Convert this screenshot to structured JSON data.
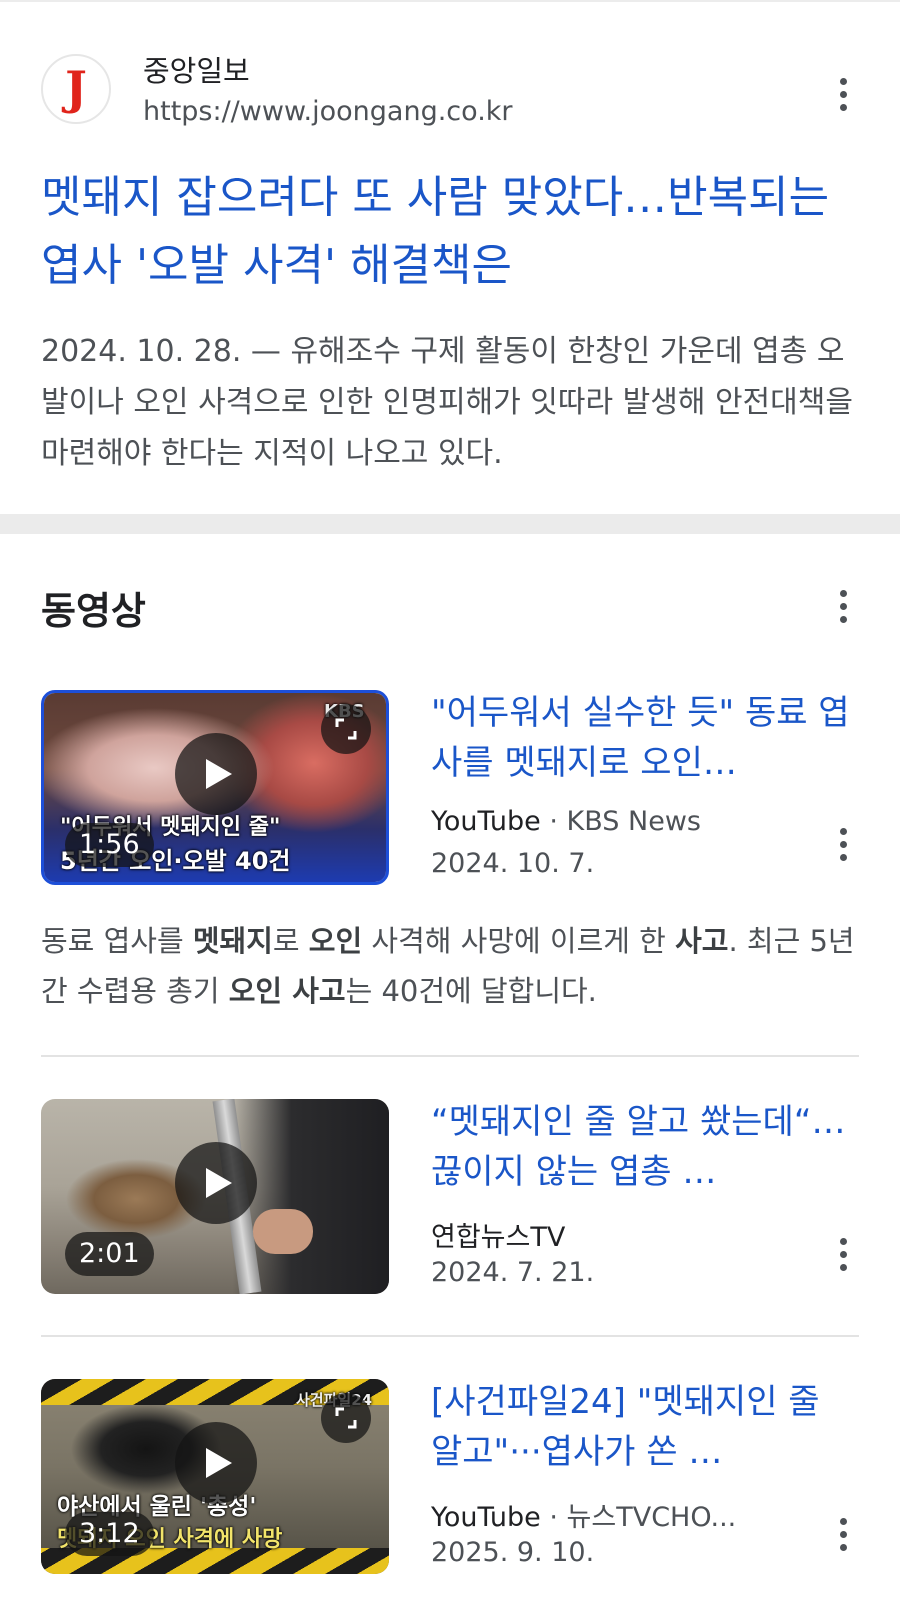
{
  "news": {
    "logo_letter": "J",
    "site_name": "중앙일보",
    "site_url": "https://www.joongang.co.kr",
    "title": "멧돼지 잡으려다 또 사람 맞았다…반복되는 엽사 '오발 사격' 해결책은",
    "snippet": "2024. 10. 28. — 유해조수 구제 활동이 한창인 가운데 엽총 오발이나 오인 사격으로 인한 인명피해가 잇따라 발생해 안전대책을 마련해야 한다는 지적이 나오고 있다."
  },
  "videos": {
    "header": "동영상",
    "items": [
      {
        "thumb_line1": "\"어두워서 멧돼지인 줄\"",
        "thumb_line2": "5년간 오인·오발 40건",
        "thumb_brand": "KBS",
        "duration": "1:56",
        "title": "\"어두워서 실수한 듯\" 동료 엽사를 멧돼지로 오인…",
        "platform": "YouTube",
        "separator": " · ",
        "channel": "KBS News",
        "date": "2024. 10. 7.",
        "snippet_parts": [
          {
            "text": "동료 엽사를 ",
            "bold": false
          },
          {
            "text": "멧돼지",
            "bold": true
          },
          {
            "text": "로 ",
            "bold": false
          },
          {
            "text": "오인",
            "bold": true
          },
          {
            "text": " 사격해 사망에 이르게 한 ",
            "bold": false
          },
          {
            "text": "사고",
            "bold": true
          },
          {
            "text": ". 최근 5년간 수렵용 총기 ",
            "bold": false
          },
          {
            "text": "오인 사고",
            "bold": true
          },
          {
            "text": "는 40건에 달합니다.",
            "bold": false
          }
        ]
      },
      {
        "duration": "2:01",
        "title": "“멧돼지인 줄 알고 쐈는데“…끊이지 않는 엽총 …",
        "channel": "연합뉴스TV",
        "date": "2024. 7. 21."
      },
      {
        "thumb_line1": "야산에서 울린 '총성'",
        "thumb_line2": "멧돼지 오인 사격에 사망",
        "thumb_brand": "사건파일24",
        "duration": "3:12",
        "title": "[사건파일24] \"멧돼지인 줄 알고\"···엽사가 쏜 …",
        "platform": "YouTube",
        "separator": " · ",
        "channel": "뉴스TVCHO...",
        "date": "2025. 9. 10."
      }
    ]
  },
  "colors": {
    "link": "#1a56c8",
    "secondary_text": "#4d5156",
    "logo_red": "#e0241b",
    "separator": "#ebebeb"
  },
  "icons": [
    "more-vert-icon",
    "play-icon",
    "expand-icon"
  ]
}
